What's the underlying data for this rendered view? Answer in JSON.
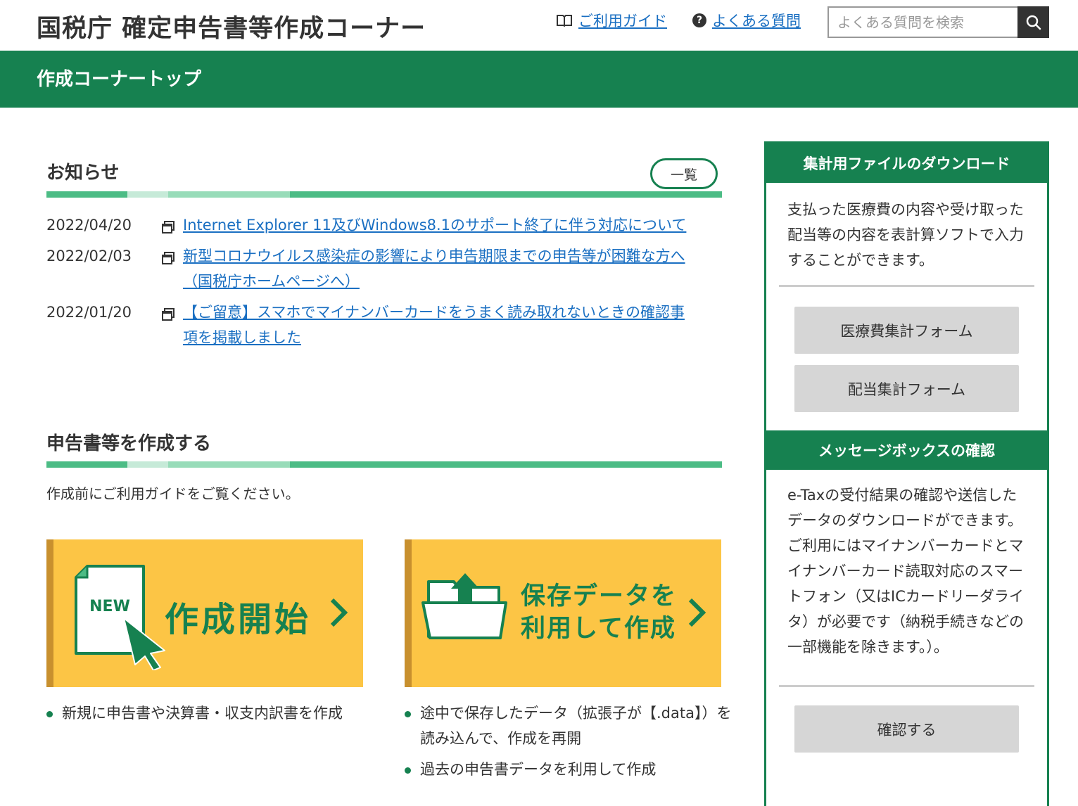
{
  "header": {
    "site_title": "国税庁 確定申告書等作成コーナー",
    "guide_link": "ご利用ガイド",
    "faq_link": "よくある質問",
    "search_placeholder": "よくある質問を検索",
    "guide_icon": "book-icon",
    "faq_icon": "question-circle-icon",
    "search_icon": "search-icon"
  },
  "band": {
    "title": "作成コーナートップ"
  },
  "news": {
    "title": "お知らせ",
    "list_button": "一覧",
    "items": [
      {
        "date": "2022/04/20",
        "text": "Internet Explorer 11及びWindows8.1のサポート終了に伴う対応について"
      },
      {
        "date": "2022/02/03",
        "text": "新型コロナウイルス感染症の影響により申告期限までの申告等が困難な方へ（国税庁ホームページへ）"
      },
      {
        "date": "2022/01/20",
        "text": "【ご留意】スマホでマイナンバーカードをうまく読み取れないときの確認事項を掲載しました"
      }
    ],
    "link_icon": "external-window-icon"
  },
  "create": {
    "title": "申告書等を作成する",
    "intro": "作成前にご利用ガイドをご覧ください。",
    "start_card": {
      "label": "作成開始",
      "badge": "NEW"
    },
    "data_card": {
      "line1": "保存データを",
      "line2": "利用して作成"
    },
    "start_bullets": [
      "新規に申告書や決算書・収支内訳書を作成"
    ],
    "data_bullets": [
      "途中で保存したデータ（拡張子が【.data】）を読み込んで、作成を再開",
      "過去の申告書データを利用して作成"
    ]
  },
  "sidebar": {
    "download": {
      "title": "集計用ファイルのダウンロード",
      "text": "支払った医療費の内容や受け取った配当等の内容を表計算ソフトで入力することができます。",
      "button1": "医療費集計フォーム",
      "button2": "配当集計フォーム"
    },
    "messagebox": {
      "title": "メッセージボックスの確認",
      "text1": "e-Taxの受付結果の確認や送信したデータのダウンロードができます。",
      "text2": "ご利用にはマイナンバーカードとマイナンバーカード読取対応のスマートフォン（又はICカードリーダライタ）が必要です（納税手続きなどの一部機能を除きます。）。",
      "button": "確認する"
    }
  },
  "colors": {
    "green": "#168150",
    "light_green": "#4cbc85",
    "card_yellow": "#fcc545",
    "card_border": "#c8902e",
    "link": "#1a6fc2"
  }
}
